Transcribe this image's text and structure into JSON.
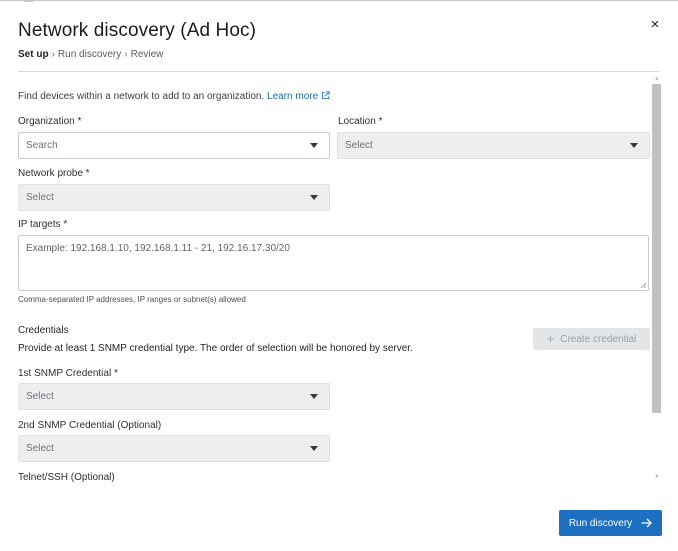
{
  "dialog": {
    "title": "Network discovery (Ad Hoc)",
    "close_glyph": "×"
  },
  "breadcrumb": {
    "steps": [
      "Set up",
      "Run discovery",
      "Review"
    ],
    "current_index": 0,
    "separator": "›"
  },
  "intro": {
    "text": "Find devices within a network to add to an organization.",
    "link_label": "Learn more",
    "link_icon": "external-link-icon"
  },
  "organization": {
    "label": "Organization *",
    "placeholder": "Search",
    "enabled": true
  },
  "location": {
    "label": "Location *",
    "placeholder": "Select",
    "enabled": false
  },
  "network_probe": {
    "label": "Network probe *",
    "placeholder": "Select",
    "enabled": false
  },
  "ip_targets": {
    "label": "IP targets *",
    "placeholder": "Example: 192.168.1.10, 192.168.1.11 - 21, 192.16.17.30/20",
    "hint": "Comma-separated IP addresses, IP ranges or subnet(s) allowed"
  },
  "credentials": {
    "title": "Credentials",
    "description": "Provide at least 1 SNMP credential type. The order of selection will be honored by server.",
    "create_button": {
      "label": "Create credential",
      "icon": "plus-icon",
      "enabled": false
    },
    "snmp1": {
      "label": "1st SNMP Credential *",
      "placeholder": "Select",
      "enabled": false
    },
    "snmp2": {
      "label": "2nd SNMP Credential (Optional)",
      "placeholder": "Select",
      "enabled": false
    },
    "telnet_label": "Telnet/SSH (Optional)"
  },
  "footer": {
    "run_button": {
      "label": "Run discovery",
      "icon": "arrow-right-icon"
    }
  },
  "colors": {
    "primary": "#1d6fc2",
    "link": "#1a6dbf",
    "disabled_fill": "#eeeeee",
    "border": "#c8ccd2"
  }
}
